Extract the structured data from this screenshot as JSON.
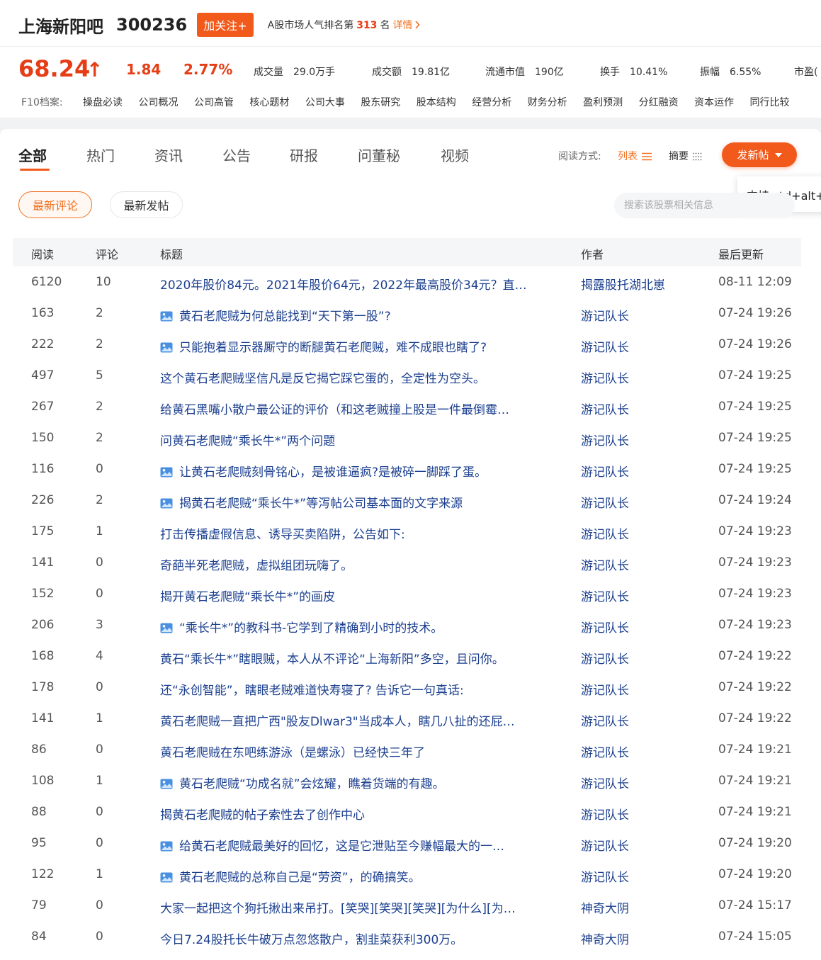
{
  "header": {
    "bar_name": "上海新阳吧",
    "stock_code": "300236",
    "follow_label": "加关注+",
    "rank_prefix": "A股市场人气排名第",
    "rank_value": "313",
    "rank_suffix": "名",
    "detail_label": "详情"
  },
  "quote": {
    "price": "68.24",
    "change": "1.84",
    "change_pct": "2.77%",
    "stats": [
      {
        "label": "成交量",
        "value": "29.0万手"
      },
      {
        "label": "成交额",
        "value": "19.81亿"
      },
      {
        "label": "流通市值",
        "value": "190亿"
      },
      {
        "label": "换手",
        "value": "10.41%"
      },
      {
        "label": "振幅",
        "value": "6.55%"
      },
      {
        "label": "市盈(",
        "value": ""
      }
    ],
    "accent_color": "#e53d15"
  },
  "f10": {
    "label": "F10档案:",
    "links": [
      "操盘必读",
      "公司概况",
      "公司高管",
      "核心题材",
      "公司大事",
      "股东研究",
      "股本结构",
      "经营分析",
      "财务分析",
      "盈利预测",
      "分红融资",
      "资本运作",
      "同行比较"
    ]
  },
  "tabs": [
    "全部",
    "热门",
    "资讯",
    "公告",
    "研报",
    "问董秘",
    "视频"
  ],
  "read_mode": {
    "label": "阅读方式:",
    "list_label": "列表",
    "summary_label": "摘要"
  },
  "post_button_label": "发新帖",
  "tooltip_text": "支持 ctrl+alt+",
  "filters": {
    "latest_comment": "最新评论",
    "latest_post": "最新发帖"
  },
  "search": {
    "placeholder": "搜索该股票相关信息"
  },
  "table": {
    "headers": {
      "read": "阅读",
      "comment": "评论",
      "title": "标题",
      "author": "作者",
      "updated": "最后更新"
    },
    "rows": [
      {
        "read": "6120",
        "comment": "10",
        "title": "2020年股价84元。2021年股价64元，2022年最高股价34元？直…",
        "has_image": false,
        "author": "揭露股托湖北崽",
        "time": "08-11 12:09"
      },
      {
        "read": "163",
        "comment": "2",
        "title": "黄石老爬贼为何总能找到“天下第一股”?",
        "has_image": true,
        "author": "游记队长",
        "time": "07-24 19:26"
      },
      {
        "read": "222",
        "comment": "2",
        "title": "只能抱着显示器厮守的断腿黄石老爬贼，难不成眼也瞎了?",
        "has_image": true,
        "author": "游记队长",
        "time": "07-24 19:26"
      },
      {
        "read": "497",
        "comment": "5",
        "title": "这个黄石老爬贼坚信凡是反它揭它踩它蛋的，全定性为空头。",
        "has_image": false,
        "author": "游记队长",
        "time": "07-24 19:25"
      },
      {
        "read": "267",
        "comment": "2",
        "title": "给黄石黑嘴小散户最公证的评价（和这老贼撞上股是一件最倒霉…",
        "has_image": false,
        "author": "游记队长",
        "time": "07-24 19:25"
      },
      {
        "read": "150",
        "comment": "2",
        "title": "问黄石老爬贼“乘长牛*”两个问题",
        "has_image": false,
        "author": "游记队长",
        "time": "07-24 19:25"
      },
      {
        "read": "116",
        "comment": "0",
        "title": "让黄石老爬贼刻骨铭心，是被谁逼疯?是被碎一脚踩了蛋。",
        "has_image": true,
        "author": "游记队长",
        "time": "07-24 19:25"
      },
      {
        "read": "226",
        "comment": "2",
        "title": "揭黄石老爬贼“乘长牛*”等泻帖公司基本面的文字来源",
        "has_image": true,
        "author": "游记队长",
        "time": "07-24 19:24"
      },
      {
        "read": "175",
        "comment": "1",
        "title": "打击传播虚假信息、诱导买卖陷阱，公告如下:",
        "has_image": false,
        "author": "游记队长",
        "time": "07-24 19:23"
      },
      {
        "read": "141",
        "comment": "0",
        "title": "奇葩半死老爬贼，虚拟组团玩嗨了。",
        "has_image": false,
        "author": "游记队长",
        "time": "07-24 19:23"
      },
      {
        "read": "152",
        "comment": "0",
        "title": "揭开黄石老爬贼“乘长牛*”的画皮",
        "has_image": false,
        "author": "游记队长",
        "time": "07-24 19:23"
      },
      {
        "read": "206",
        "comment": "3",
        "title": "“乘长牛*”的教科书-它学到了精确到小时的技术。",
        "has_image": true,
        "author": "游记队长",
        "time": "07-24 19:23"
      },
      {
        "read": "168",
        "comment": "4",
        "title": "黄石“乘长牛*”瞎眼贼，本人从不评论“上海新阳”多空，且问你。",
        "has_image": false,
        "author": "游记队长",
        "time": "07-24 19:22"
      },
      {
        "read": "178",
        "comment": "0",
        "title": "还“永创智能”，瞎眼老贼难道快寿寝了? 告诉它一句真话:",
        "has_image": false,
        "author": "游记队长",
        "time": "07-24 19:22"
      },
      {
        "read": "141",
        "comment": "1",
        "title": "黄石老爬贼一直把广西\"股友Dlwar3\"当成本人，瞎几八扯的还屁…",
        "has_image": false,
        "author": "游记队长",
        "time": "07-24 19:22"
      },
      {
        "read": "86",
        "comment": "0",
        "title": "黄石老爬贼在东吧练游泳（是螺泳）已经快三年了",
        "has_image": false,
        "author": "游记队长",
        "time": "07-24 19:21"
      },
      {
        "read": "108",
        "comment": "1",
        "title": "黄石老爬贼“功成名就”会炫耀，瞧着货端的有趣。",
        "has_image": true,
        "author": "游记队长",
        "time": "07-24 19:21"
      },
      {
        "read": "88",
        "comment": "0",
        "title": "揭黄石老爬贼的帖子索性去了创作中心",
        "has_image": false,
        "author": "游记队长",
        "time": "07-24 19:21"
      },
      {
        "read": "95",
        "comment": "0",
        "title": "给黄石老爬贼最美好的回忆，这是它泄贴至今赚幅最大的一…",
        "has_image": true,
        "author": "游记队长",
        "time": "07-24 19:20"
      },
      {
        "read": "122",
        "comment": "1",
        "title": "黄石老爬贼的总称自己是“劳资”，的确搞笑。",
        "has_image": true,
        "author": "游记队长",
        "time": "07-24 19:20"
      },
      {
        "read": "79",
        "comment": "0",
        "title": "大家一起把这个狗托揪出来吊打。[笑哭][笑哭][笑哭][为什么][为…",
        "has_image": false,
        "author": "神奇大阴",
        "time": "07-24 15:17"
      },
      {
        "read": "84",
        "comment": "0",
        "title": "今日7.24股托长牛破万点忽悠散户，割韭菜获利300万。",
        "has_image": false,
        "author": "神奇大阴",
        "time": "07-24 15:05"
      }
    ]
  }
}
